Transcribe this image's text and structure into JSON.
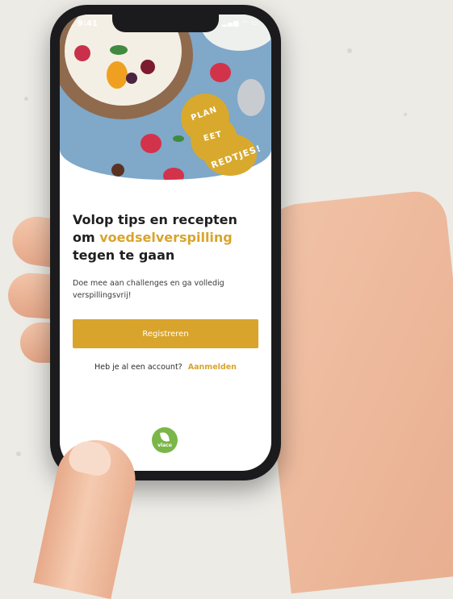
{
  "status_bar": {
    "time": "9:41",
    "icons": "signal-icon wifi-icon battery-icon"
  },
  "badge": {
    "line1": "PLAN",
    "line2": "EET",
    "line3": "REDTJES!"
  },
  "onboarding": {
    "title_part1": "Volop tips en recepten om ",
    "title_accent": "voedselverspilling",
    "title_part2": " tegen te gaan",
    "subtitle": "Doe mee aan challenges en ga volledig verspillingsvrij!",
    "register_label": "Registreren",
    "login_prompt": "Heb je al een account?",
    "login_link": "Aanmelden"
  },
  "logo": {
    "text": "vlaco"
  },
  "colors": {
    "accent": "#d9a42c",
    "logo_green": "#7ab648"
  }
}
